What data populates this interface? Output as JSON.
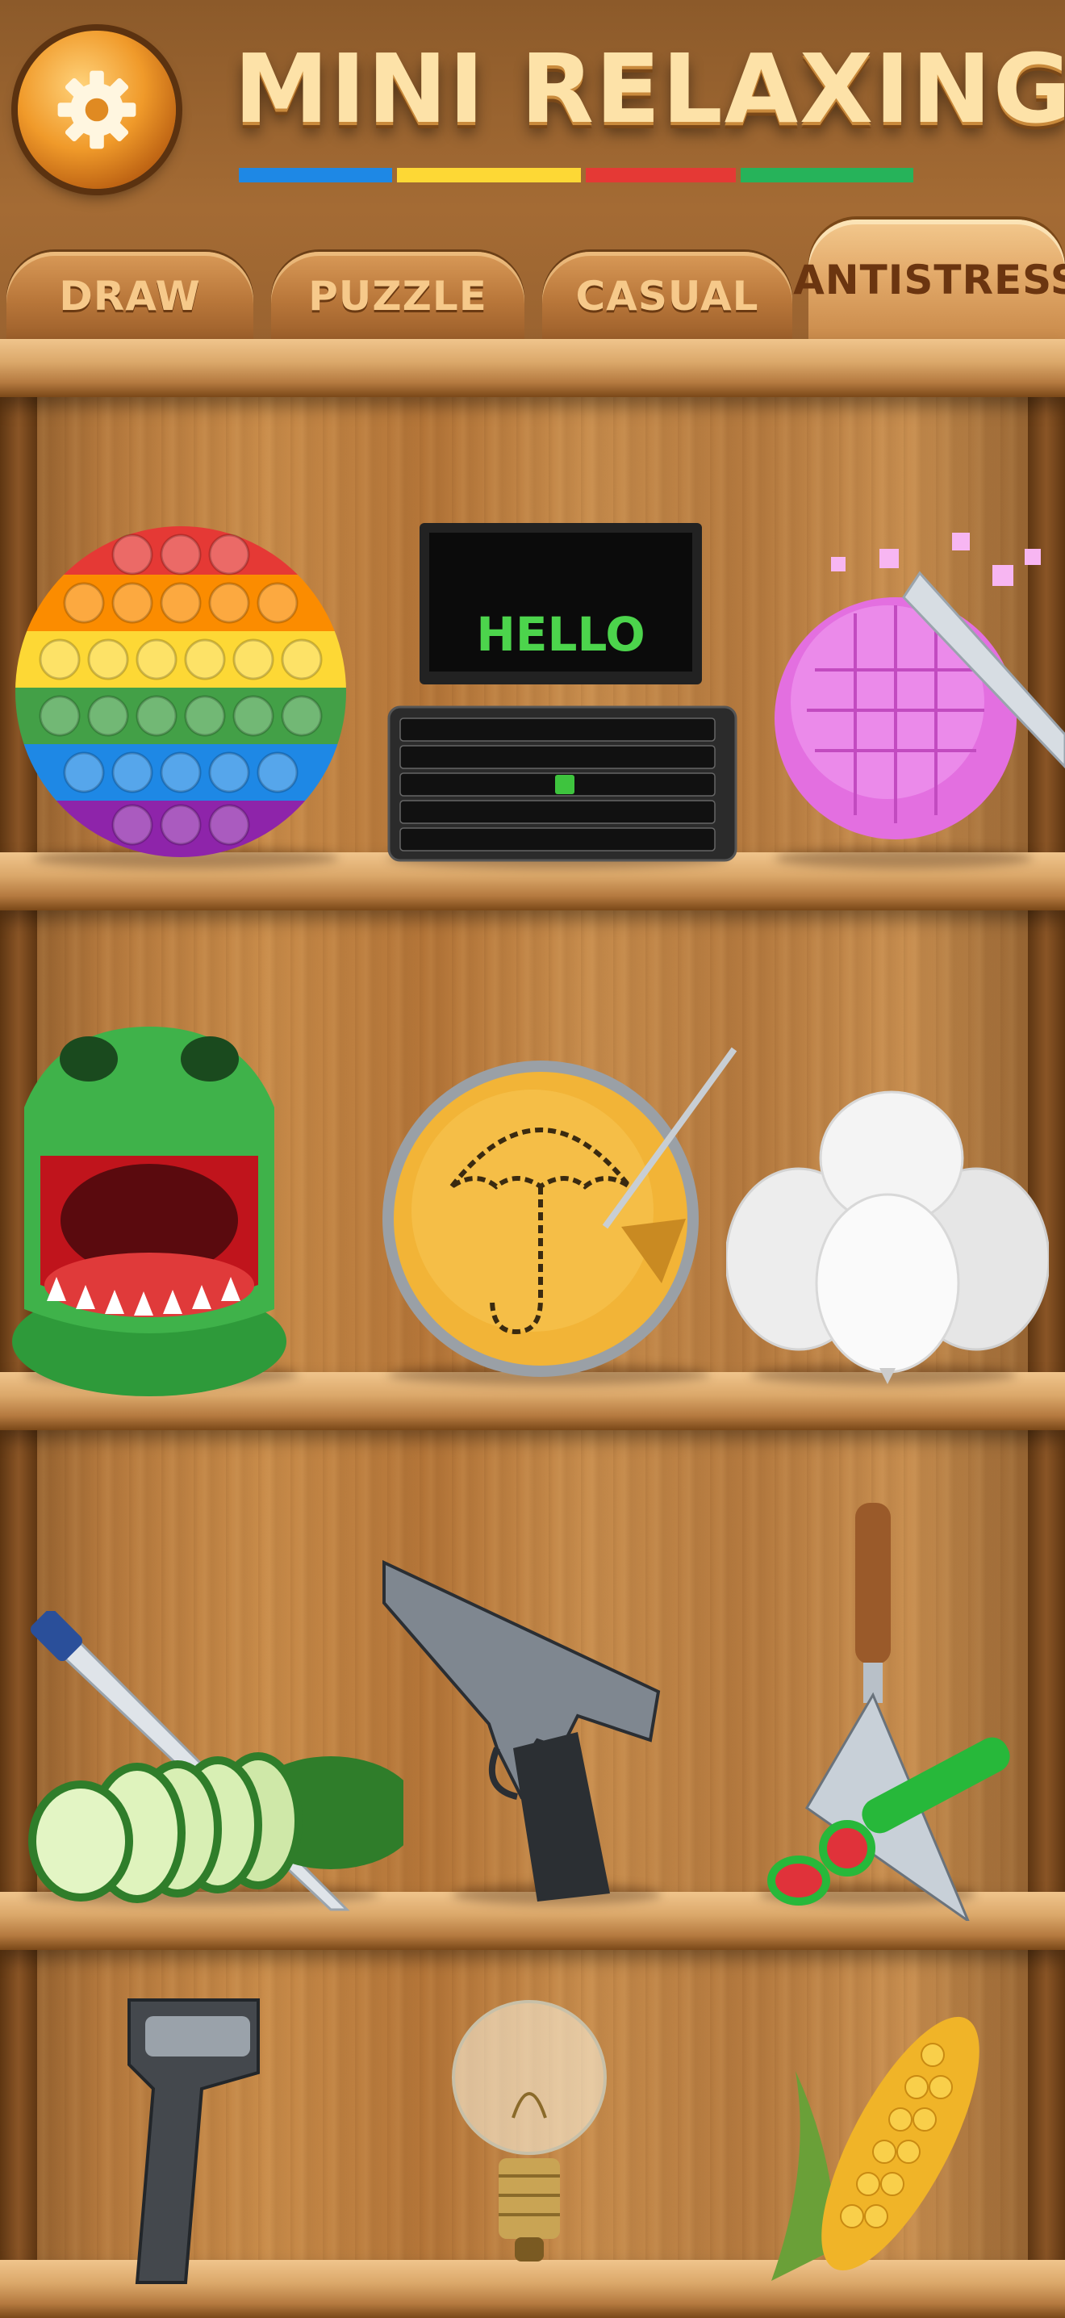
{
  "app": {
    "title": "MINI RELAXING"
  },
  "header": {
    "settings_icon": "gear-icon",
    "color_stripes": [
      "#1e88e5",
      "#fdd835",
      "#e53935",
      "#26b35a"
    ]
  },
  "tabs": [
    {
      "label": "DRAW",
      "active": false
    },
    {
      "label": "PUZZLE",
      "active": false
    },
    {
      "label": "CASUAL",
      "active": false
    },
    {
      "label": "ANTISTRESS",
      "active": true
    }
  ],
  "monitor_text": "HELLO",
  "games": [
    {
      "icon": "pop-it-icon"
    },
    {
      "icon": "keyboard-computer-icon"
    },
    {
      "icon": "soap-cutting-icon"
    },
    {
      "icon": "crocodile-dentist-icon"
    },
    {
      "icon": "honeycomb-candy-icon"
    },
    {
      "icon": "balloons-icon"
    },
    {
      "icon": "cucumber-slicing-icon"
    },
    {
      "icon": "pistol-icon"
    },
    {
      "icon": "watermelon-cutting-icon"
    },
    {
      "icon": "barcode-scanner-icon"
    },
    {
      "icon": "light-bulb-icon"
    },
    {
      "icon": "corn-icon"
    }
  ]
}
